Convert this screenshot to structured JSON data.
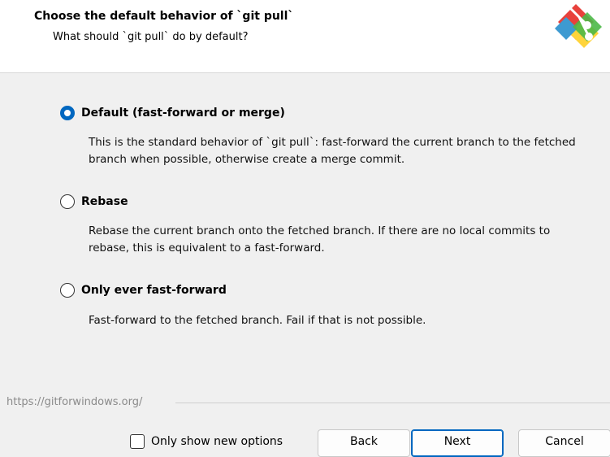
{
  "header": {
    "title": "Choose the default behavior of `git pull`",
    "subtitle": "What should `git pull` do by default?",
    "logo_icon": "git-for-windows-logo-icon",
    "logo_colors": [
      "#e8413c",
      "#ffd43b",
      "#4cb848",
      "#3d9ad1"
    ]
  },
  "options": [
    {
      "label": "Default (fast-forward or merge)",
      "description": "This is the standard behavior of `git pull`: fast-forward the current branch to the fetched branch when possible, otherwise create a merge commit.",
      "selected": true
    },
    {
      "label": "Rebase",
      "description": "Rebase the current branch onto the fetched branch. If there are no local commits to rebase, this is equivalent to a fast-forward.",
      "selected": false
    },
    {
      "label": "Only ever fast-forward",
      "description": "Fast-forward to the fetched branch. Fail if that is not possible.",
      "selected": false
    }
  ],
  "footer": {
    "url": "https://gitforwindows.org/",
    "only_new_label": "Only show new options",
    "only_new_checked": false,
    "back_label": "Back",
    "next_label": "Next",
    "cancel_label": "Cancel"
  },
  "colors": {
    "accent": "#0067c0"
  }
}
